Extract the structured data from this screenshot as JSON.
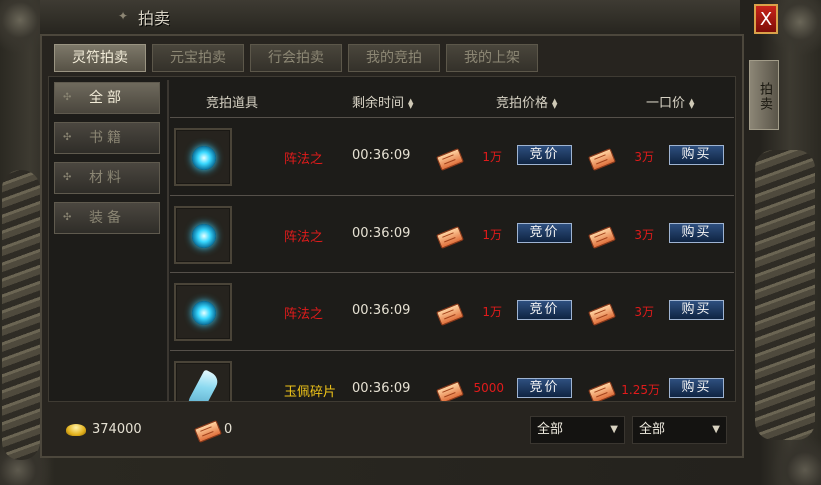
{
  "window": {
    "title": "拍卖",
    "close_label": "X",
    "side_tab": "拍卖"
  },
  "tabs": [
    {
      "label": "灵符拍卖",
      "active": true
    },
    {
      "label": "元宝拍卖",
      "active": false
    },
    {
      "label": "行会拍卖",
      "active": false
    },
    {
      "label": "我的竞拍",
      "active": false
    },
    {
      "label": "我的上架",
      "active": false
    }
  ],
  "categories": [
    {
      "label": "全部",
      "active": true
    },
    {
      "label": "书籍",
      "active": false
    },
    {
      "label": "材料",
      "active": false
    },
    {
      "label": "装备",
      "active": false
    }
  ],
  "columns": {
    "item": "竞拍道具",
    "time": "剩余时间",
    "bid": "竞拍价格",
    "buyout": "一口价"
  },
  "rows": [
    {
      "icon": "blue-orb-icon",
      "name": "阵法之",
      "name_color": "#e01b1b",
      "time": "00:36:09",
      "bid": "1万",
      "bid_btn": "竞价",
      "buyout": "3万",
      "buy_btn": "购买"
    },
    {
      "icon": "blue-orb-icon",
      "name": "阵法之",
      "name_color": "#e01b1b",
      "time": "00:36:09",
      "bid": "1万",
      "bid_btn": "竞价",
      "buyout": "3万",
      "buy_btn": "购买"
    },
    {
      "icon": "blue-orb-icon",
      "name": "阵法之",
      "name_color": "#e01b1b",
      "time": "00:36:09",
      "bid": "1万",
      "bid_btn": "竞价",
      "buyout": "3万",
      "buy_btn": "购买"
    },
    {
      "icon": "jade-shard-icon",
      "name": "玉佩碎片",
      "name_color": "#f0c419",
      "time": "00:36:09",
      "bid": "5000",
      "bid_btn": "竞价",
      "buyout": "1.25万",
      "buy_btn": "购买"
    }
  ],
  "footer": {
    "gold": "374000",
    "talisman": "0",
    "filter1": "全部",
    "filter2": "全部"
  },
  "colors": {
    "accent_red": "#e01b1b",
    "button_blue": "#1c3a63"
  }
}
